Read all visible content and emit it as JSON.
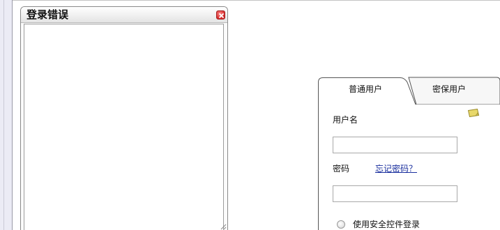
{
  "error_dialog": {
    "title": "登录错误"
  },
  "login": {
    "tabs": [
      {
        "label": "普通用户",
        "active": true
      },
      {
        "label": "密保用户",
        "active": false
      }
    ],
    "username_label": "用户名",
    "username_value": "",
    "password_label": "密码",
    "forgot_password_link": "忘记密码？",
    "password_value": "",
    "security_control_label": "使用安全控件登录"
  },
  "colors": {
    "link": "#1a2f9e",
    "close_button": "#d52a2a",
    "note_icon": "#e8d86a"
  }
}
